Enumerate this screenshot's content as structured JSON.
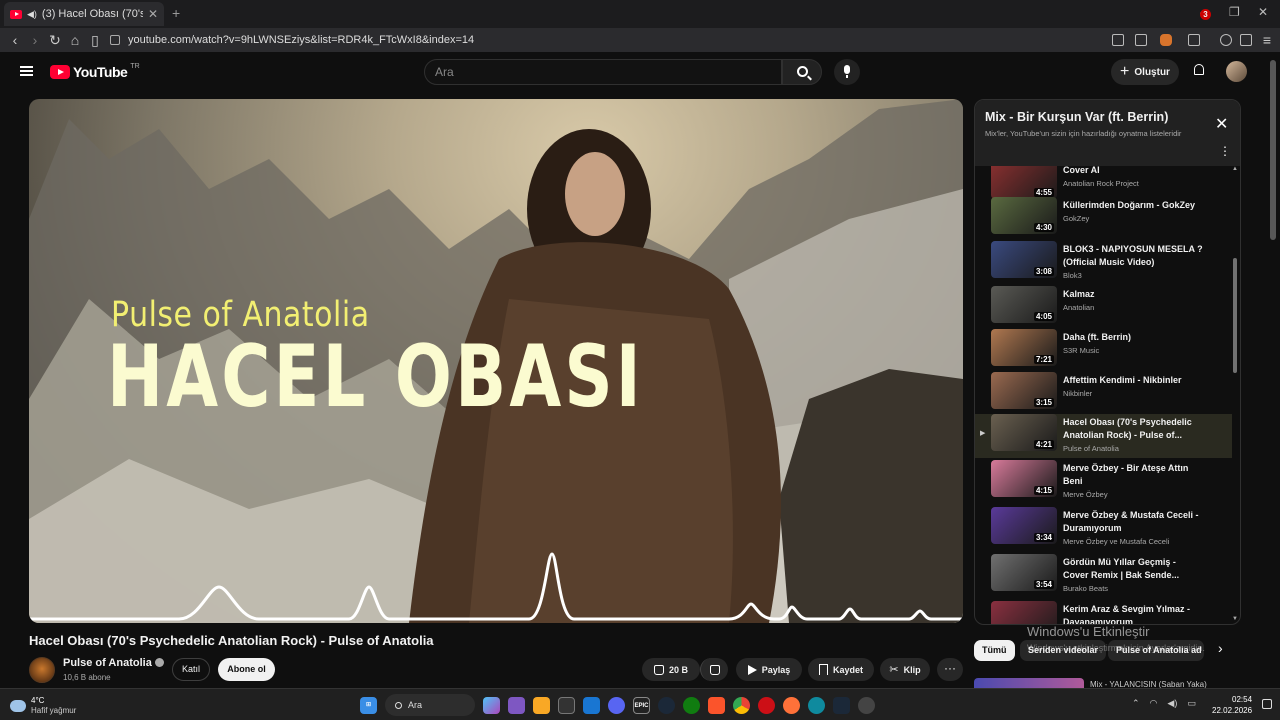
{
  "browser": {
    "tab_title": "(3) Hacel Obası (70's Psychedel",
    "url": "youtube.com/watch?v=9hLWNSEziys&list=RDR4k_FTcWxI8&index=14"
  },
  "header": {
    "logo": "YouTube",
    "country": "TR",
    "search_placeholder": "Ara",
    "create_label": "Oluştur",
    "notifications": "3"
  },
  "video": {
    "overlay_subtitle": "Pulse of Anatolia",
    "overlay_title": "HACEL OBASI",
    "title": "Hacel Obası (70's Psychedelic Anatolian Rock) - Pulse of Anatolia",
    "channel": "Pulse of Anatolia",
    "subscribers": "10,6 B abone",
    "join_label": "Katıl",
    "subscribe_label": "Abone ol",
    "likes": "20 B",
    "share_label": "Paylaş",
    "save_label": "Kaydet",
    "clip_label": "Klip",
    "more_label": "···"
  },
  "playlist": {
    "title": "Mix - Bir Kurşun Var (ft. Berrin)",
    "subtitle": "Mix'ler, YouTube'un sizin için hazırladığı oynatma listeleridir",
    "items": [
      {
        "title": "Cover AI",
        "channel": "Anatolian Rock Project",
        "duration": "4:55",
        "thumb": "#8a3030",
        "active": false
      },
      {
        "title": "Küllerimden Doğarım - GokZey",
        "channel": "GokZey",
        "duration": "4:30",
        "thumb": "#5a6a40",
        "active": false
      },
      {
        "title": "BLOK3 - NAPIYOSUN MESELA ? (Official Music Video)",
        "channel": "Blok3",
        "duration": "3:08",
        "thumb": "#3a4a80",
        "active": false
      },
      {
        "title": "Kalmaz",
        "channel": "Anatolian",
        "duration": "4:05",
        "thumb": "#5a5a55",
        "active": false
      },
      {
        "title": "Daha (ft. Berrin)",
        "channel": "S3R Music",
        "duration": "7:21",
        "thumb": "#b07850",
        "active": false
      },
      {
        "title": "Affettim Kendimi - Nikbinler",
        "channel": "Nikbinler",
        "duration": "3:15",
        "thumb": "#9a6a50",
        "active": false
      },
      {
        "title": "Hacel Obası (70's Psychedelic Anatolian Rock) - Pulse of...",
        "channel": "Pulse of Anatolia",
        "duration": "4:21",
        "thumb": "#6a6050",
        "active": true
      },
      {
        "title": "Merve Özbey - Bir Ateşe Attın Beni",
        "channel": "Merve Özbey",
        "duration": "4:15",
        "thumb": "#d87a9a",
        "active": false
      },
      {
        "title": "Merve Özbey & Mustafa Ceceli - Duramıyorum",
        "channel": "Merve Özbey ve Mustafa Ceceli",
        "duration": "3:34",
        "thumb": "#5a3a9a",
        "active": false
      },
      {
        "title": "Gördün Mü Yıllar Geçmiş - Cover Remix | Bak Sende...",
        "channel": "Burako Beats",
        "duration": "3:54",
        "thumb": "#707070",
        "active": false
      },
      {
        "title": "Kerim Araz & Sevgim Yılmaz - Dayanamıyorum",
        "channel": "",
        "duration": "",
        "thumb": "#8a3040",
        "active": false
      }
    ]
  },
  "chips": [
    "Tümü",
    "Seriden videolar",
    "Pulse of Anatolia ad"
  ],
  "watermark": {
    "line1": "Windows'u Etkinleştir",
    "line2": "Windows'u etkinleştirmek için Ayarlar'a gidin."
  },
  "next_peek": "Mix - YALANCISIN (Saban Yaka)",
  "taskbar": {
    "temp": "4°C",
    "condition": "Hafif yağmur",
    "search_label": "Ara",
    "time": "02:54",
    "date": "22.02.2026"
  },
  "colors": {
    "accent": "#ff0033",
    "overlay_yellow": "#f2ef72",
    "overlay_cream": "#fbfbd0"
  }
}
